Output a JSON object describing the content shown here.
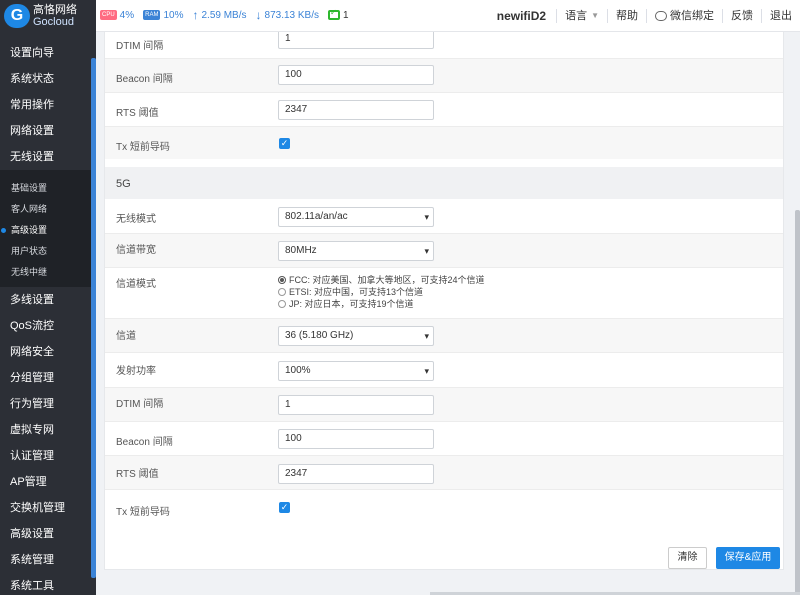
{
  "logo": {
    "cn": "高恪网络",
    "en": "Gocloud"
  },
  "stats": {
    "cpu_badge": "CPU",
    "cpu": "4%",
    "ram_badge": "RAM",
    "ram": "10%",
    "upload": "2.59 MB/s",
    "download": "873.13 KB/s",
    "devices": "1"
  },
  "topright": {
    "router_name": "newifiD2",
    "language": "语言",
    "help": "帮助",
    "wechat": "微信绑定",
    "feedback": "反馈",
    "logout": "退出"
  },
  "sidebar": {
    "top_items": [
      "设置向导",
      "系统状态",
      "常用操作",
      "网络设置",
      "无线设置"
    ],
    "sub_items": [
      "基础设置",
      "客人网络",
      "高级设置",
      "用户状态",
      "无线中继"
    ],
    "active_sub": "高级设置",
    "bottom_items": [
      "多线设置",
      "QoS流控",
      "网络安全",
      "分组管理",
      "行为管理",
      "虚拟专网",
      "认证管理",
      "AP管理",
      "交换机管理",
      "高级设置",
      "系统管理",
      "系统工具"
    ]
  },
  "form24": {
    "dtim_label": "DTIM 间隔",
    "dtim_value": "1",
    "beacon_label": "Beacon 间隔",
    "beacon_value": "100",
    "rts_label": "RTS 阈值",
    "rts_value": "2347",
    "tx_label": "Tx 短前导码",
    "tx_checked": true
  },
  "form5g": {
    "section_title": "5G",
    "mode_label": "无线模式",
    "mode_value": "802.11a/an/ac",
    "bandwidth_label": "信道带宽",
    "bandwidth_value": "80MHz",
    "channel_mode_label": "信道模式",
    "channel_mode_options": [
      "FCC: 对应美国、加拿大等地区，可支持24个信道",
      "ETSI: 对应中国，可支持13个信道",
      "JP: 对应日本，可支持19个信道"
    ],
    "channel_mode_selected": 0,
    "channel_label": "信道",
    "channel_value": "36 (5.180 GHz)",
    "power_label": "发射功率",
    "power_value": "100%",
    "dtim_label": "DTIM 间隔",
    "dtim_value": "1",
    "beacon_label": "Beacon 间隔",
    "beacon_value": "100",
    "rts_label": "RTS 阈值",
    "rts_value": "2347",
    "tx_label": "Tx 短前导码",
    "tx_checked": true
  },
  "buttons": {
    "clear": "清除",
    "save": "保存&应用"
  }
}
